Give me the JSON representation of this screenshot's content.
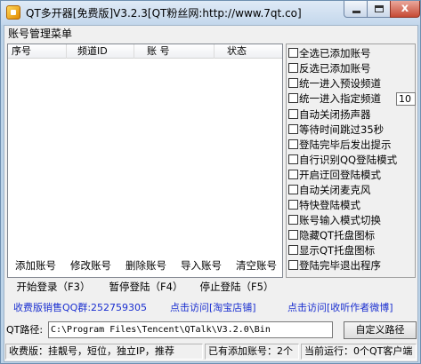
{
  "window": {
    "title": "QT多开器[免费版]V3.2.3[QT粉丝网:http://www.7qt.co]",
    "close_glyph": "x"
  },
  "menu_header": "账号管理菜单",
  "list": {
    "columns": [
      "序号",
      "频道ID",
      "账   号",
      "状态"
    ]
  },
  "options": [
    {
      "label": "全选已添加账号",
      "checked": false
    },
    {
      "label": "反选已添加账号",
      "checked": false
    },
    {
      "label": "统一进入预设频道",
      "checked": false
    },
    {
      "label": "统一进入指定频道",
      "checked": false
    },
    {
      "label": "自动关闭扬声器",
      "checked": false
    },
    {
      "label": "等待时间跳过35秒",
      "checked": false
    },
    {
      "label": "登陆完毕后发出提示",
      "checked": false
    },
    {
      "label": "自行识别QQ登陆模式",
      "checked": false
    },
    {
      "label": "开启迂回登陆模式",
      "checked": false
    },
    {
      "label": "自动关闭麦克风",
      "checked": false
    },
    {
      "label": "特快登陆模式",
      "checked": false
    },
    {
      "label": "账号输入模式切换",
      "checked": false
    },
    {
      "label": "隐藏QT托盘图标",
      "checked": false
    },
    {
      "label": "显示QT托盘图标",
      "checked": false
    },
    {
      "label": "登陆完毕退出程序",
      "checked": false
    }
  ],
  "channel_value": "10",
  "toolbar_row1": [
    "添加账号",
    "修改账号",
    "删除账号",
    "导入账号",
    "清空账号"
  ],
  "toolbar_row2": [
    "开始登录（F3）",
    "暂停登陆（F4）",
    "停止登陆（F5）"
  ],
  "links": {
    "sales": "收费版销售QQ群:252759305",
    "taobao": "点击访问[淘宝店铺]",
    "weibo": "点击访问[收听作者微博]"
  },
  "path": {
    "label": "QT路径:",
    "value": "C:\\Program Files\\Tencent\\QTalk\\V3.2.0\\Bin",
    "button": "自定义路径"
  },
  "status": {
    "edition": "收费版：挂靓号，短位，独立IP，推荐",
    "added": "已有添加账号：2个",
    "running": "当前运行：0个QT客户端"
  },
  "colors": {
    "link": "#1a2fd0",
    "titlebar": "#c3d7ec",
    "close": "#c64a34"
  }
}
